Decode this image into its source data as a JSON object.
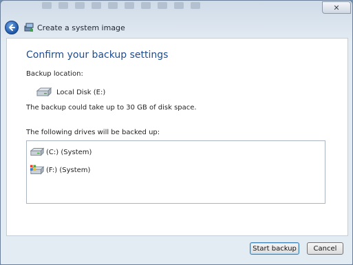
{
  "window": {
    "title": "Create a system image",
    "close_glyph": "✕"
  },
  "content": {
    "heading": "Confirm your backup settings",
    "backup_location_label": "Backup location:",
    "backup_location_value": "Local Disk (E:)",
    "space_note": "The backup could take up to 30 GB of disk space.",
    "drives_label": "The following drives will be backed up:",
    "drives": [
      {
        "label": "(C:) (System)",
        "icon": "hard-drive-icon"
      },
      {
        "label": "(F:) (System)",
        "icon": "windows-drive-icon"
      }
    ]
  },
  "buttons": {
    "start": "Start backup",
    "cancel": "Cancel"
  }
}
